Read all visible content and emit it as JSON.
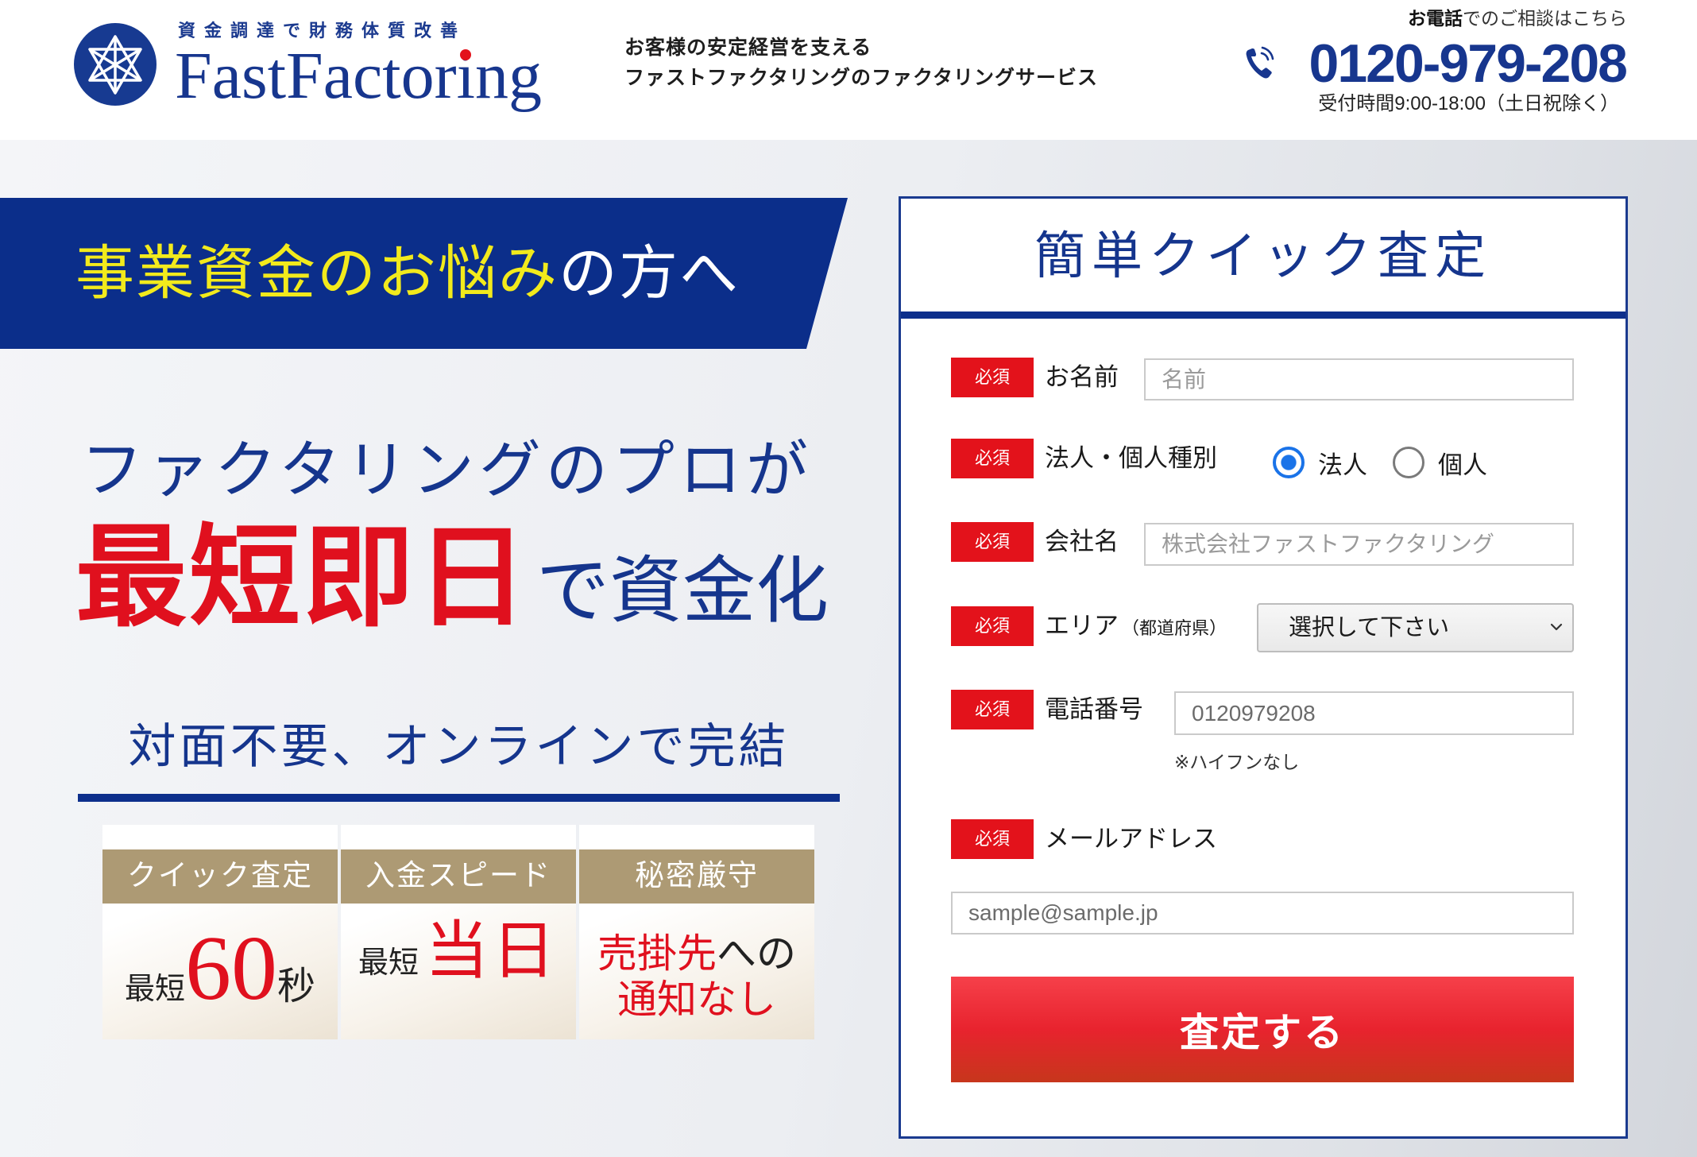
{
  "header": {
    "brand": {
      "tagline": "資金調達で財務体質改善",
      "name": "FastFactoring",
      "logo_icon": "star-emblem-icon"
    },
    "catch": {
      "line1": "お客様の安定経営を支える",
      "line2": "ファストファクタリングのファクタリングサービス"
    },
    "contact": {
      "lead_strong": "お電話",
      "lead_rest": "でのご相談はこちら",
      "icon": "phone-icon",
      "phone": "0120-979-208",
      "hours": "受付時間9:00-18:00（土日祝除く）"
    }
  },
  "hero": {
    "banner": {
      "highlight": "事業資金のお悩み",
      "rest": "の方へ"
    },
    "headline1": "ファクタリングのプロが",
    "headline2_emph": "最短即日",
    "headline2_rest": "で資金化",
    "subhead": "対面不要、オンラインで完結",
    "features": [
      {
        "title": "クイック査定",
        "prefix": "最短",
        "value": "60",
        "suffix": "秒"
      },
      {
        "title": "入金スピード",
        "prefix": "最短",
        "value": "当日"
      },
      {
        "title": "秘密厳守",
        "line1_emph": "売掛先",
        "line1_rest": "への",
        "line2": "通知なし"
      }
    ]
  },
  "form": {
    "title": "簡単クイック査定",
    "required_label": "必須",
    "fields": {
      "name": {
        "label": "お名前",
        "placeholder": "名前"
      },
      "type": {
        "label": "法人・個人種別",
        "options": [
          "法人",
          "個人"
        ],
        "selected_index": 0
      },
      "company": {
        "label": "会社名",
        "placeholder": "株式会社ファストファクタリング"
      },
      "area": {
        "label": "エリア",
        "sublabel": "（都道府県）",
        "selected": "選択して下さい"
      },
      "phone": {
        "label": "電話番号",
        "placeholder": "0120979208",
        "note": "※ハイフンなし"
      },
      "email": {
        "label": "メールアドレス",
        "placeholder": "sample@sample.jp"
      }
    },
    "submit": "査定する"
  },
  "colors": {
    "navy": "#0b2e8a",
    "red": "#e0101e",
    "yellow": "#f2ea1c",
    "gold": "#ad9a74",
    "radio_blue": "#1a73e8"
  }
}
